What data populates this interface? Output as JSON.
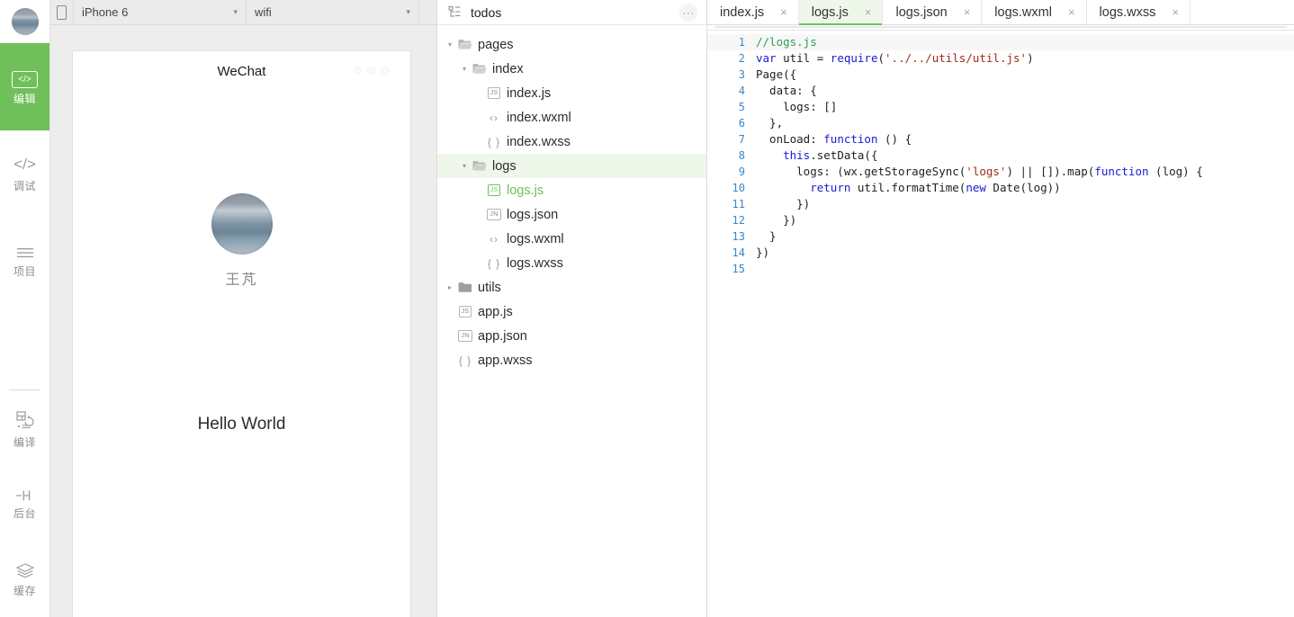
{
  "rail": {
    "avatar_icon": "user-avatar-photo",
    "top_items": [
      {
        "label": "编辑",
        "icon": "code-brackets-icon",
        "active": true
      },
      {
        "label": "调试",
        "icon": "code-slash-icon",
        "active": false
      },
      {
        "label": "项目",
        "icon": "list-lines-icon",
        "active": false
      }
    ],
    "bottom_items": [
      {
        "label": "编译",
        "icon": "compile-refresh-icon"
      },
      {
        "label": "后台",
        "icon": "background-bracket-icon"
      },
      {
        "label": "缓存",
        "icon": "layers-stack-icon"
      }
    ]
  },
  "simulator": {
    "toolbar": {
      "device_icon": "phone-outline-icon",
      "device": "iPhone 6",
      "network": "wifi",
      "caret": "▾"
    },
    "device_title": "WeChat",
    "nav_dots_icon": "three-dots-icon",
    "user_name": "王芃",
    "avatar_icon": "profile-photo",
    "body_text": "Hello World"
  },
  "file_tree": {
    "header_icon": "project-tree-icon",
    "project_name": "todos",
    "more_label": "···",
    "nodes": [
      {
        "label": "pages",
        "type": "folder-open",
        "depth": 0,
        "arrow": "▾",
        "highlight": false,
        "selected": false
      },
      {
        "label": "index",
        "type": "folder-open",
        "depth": 1,
        "arrow": "▾",
        "highlight": false,
        "selected": false
      },
      {
        "label": "index.js",
        "type": "js",
        "depth": 2,
        "arrow": "",
        "highlight": false,
        "selected": false
      },
      {
        "label": "index.wxml",
        "type": "wxml",
        "depth": 2,
        "arrow": "",
        "highlight": false,
        "selected": false
      },
      {
        "label": "index.wxss",
        "type": "wxss",
        "depth": 2,
        "arrow": "",
        "highlight": false,
        "selected": false
      },
      {
        "label": "logs",
        "type": "folder-open",
        "depth": 1,
        "arrow": "▾",
        "highlight": true,
        "selected": false
      },
      {
        "label": "logs.js",
        "type": "js",
        "depth": 2,
        "arrow": "",
        "highlight": false,
        "selected": true
      },
      {
        "label": "logs.json",
        "type": "json",
        "depth": 2,
        "arrow": "",
        "highlight": false,
        "selected": false
      },
      {
        "label": "logs.wxml",
        "type": "wxml",
        "depth": 2,
        "arrow": "",
        "highlight": false,
        "selected": false
      },
      {
        "label": "logs.wxss",
        "type": "wxss",
        "depth": 2,
        "arrow": "",
        "highlight": false,
        "selected": false
      },
      {
        "label": "utils",
        "type": "folder-closed",
        "depth": 0,
        "arrow": "▸",
        "highlight": false,
        "selected": false
      },
      {
        "label": "app.js",
        "type": "js",
        "depth": 0,
        "arrow": "",
        "highlight": false,
        "selected": false
      },
      {
        "label": "app.json",
        "type": "json",
        "depth": 0,
        "arrow": "",
        "highlight": false,
        "selected": false
      },
      {
        "label": "app.wxss",
        "type": "wxss",
        "depth": 0,
        "arrow": "",
        "highlight": false,
        "selected": false
      }
    ],
    "icon_text": {
      "js": "JS",
      "json": "JN",
      "wxml": "‹›",
      "wxss": "{ }"
    }
  },
  "editor": {
    "close_glyph": "×",
    "tabs": [
      {
        "label": "index.js",
        "active": false
      },
      {
        "label": "logs.js",
        "active": true
      },
      {
        "label": "logs.json",
        "active": false
      },
      {
        "label": "logs.wxml",
        "active": false
      },
      {
        "label": "logs.wxss",
        "active": false
      }
    ],
    "lines": [
      {
        "n": "1",
        "current": true,
        "parts": [
          {
            "t": "//logs.js",
            "c": "cm"
          }
        ]
      },
      {
        "n": "2",
        "current": false,
        "parts": [
          {
            "t": "var",
            "c": "k"
          },
          {
            "t": " util = "
          },
          {
            "t": "require",
            "c": "k"
          },
          {
            "t": "("
          },
          {
            "t": "'../../utils/util.js'",
            "c": "s"
          },
          {
            "t": ")"
          }
        ]
      },
      {
        "n": "3",
        "current": false,
        "parts": [
          {
            "t": "Page({"
          }
        ]
      },
      {
        "n": "4",
        "current": false,
        "parts": [
          {
            "t": "  data: {"
          }
        ]
      },
      {
        "n": "5",
        "current": false,
        "parts": [
          {
            "t": "    logs: []"
          }
        ]
      },
      {
        "n": "6",
        "current": false,
        "parts": [
          {
            "t": "  },"
          }
        ]
      },
      {
        "n": "7",
        "current": false,
        "parts": [
          {
            "t": "  onLoad: "
          },
          {
            "t": "function",
            "c": "k"
          },
          {
            "t": " () {"
          }
        ]
      },
      {
        "n": "8",
        "current": false,
        "parts": [
          {
            "t": "    "
          },
          {
            "t": "this",
            "c": "k"
          },
          {
            "t": ".setData({"
          }
        ]
      },
      {
        "n": "9",
        "current": false,
        "parts": [
          {
            "t": "      logs: (wx.getStorageSync("
          },
          {
            "t": "'logs'",
            "c": "s"
          },
          {
            "t": ") || []).map("
          },
          {
            "t": "function",
            "c": "k"
          },
          {
            "t": " (log) {"
          }
        ]
      },
      {
        "n": "10",
        "current": false,
        "parts": [
          {
            "t": "        "
          },
          {
            "t": "return",
            "c": "k"
          },
          {
            "t": " util.formatTime("
          },
          {
            "t": "new",
            "c": "k"
          },
          {
            "t": " Date(log))"
          }
        ]
      },
      {
        "n": "11",
        "current": false,
        "parts": [
          {
            "t": "      })"
          }
        ]
      },
      {
        "n": "12",
        "current": false,
        "parts": [
          {
            "t": "    })"
          }
        ]
      },
      {
        "n": "13",
        "current": false,
        "parts": [
          {
            "t": "  }"
          }
        ]
      },
      {
        "n": "14",
        "current": false,
        "parts": [
          {
            "t": "})"
          }
        ]
      },
      {
        "n": "15",
        "current": false,
        "parts": [
          {
            "t": ""
          }
        ]
      }
    ]
  },
  "colors": {
    "accent_green": "#6fc05a",
    "tab_active_bg": "#eef7ea",
    "keyword_blue": "#1a1ad4",
    "string_red": "#9c2a18",
    "comment_green": "#2e9e4f",
    "linenum_blue": "#3c87c4"
  }
}
